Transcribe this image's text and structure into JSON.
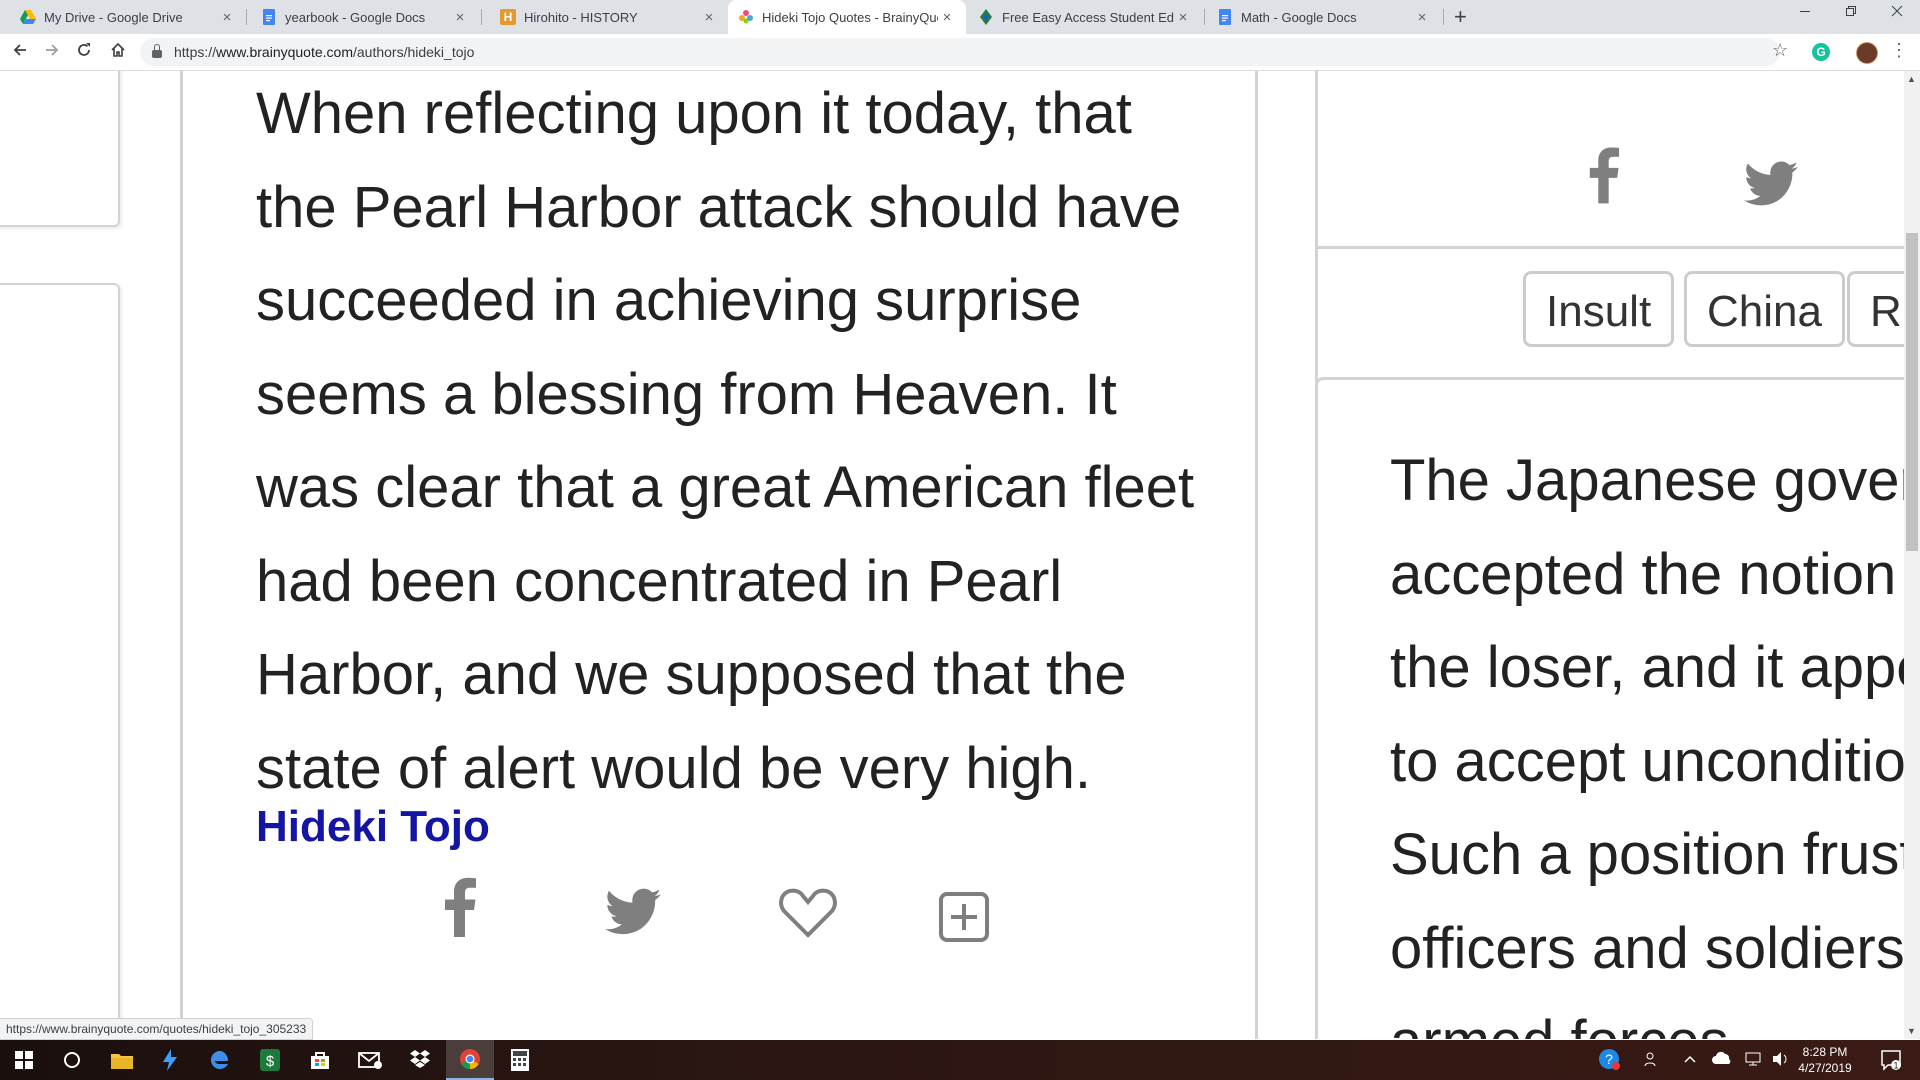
{
  "browser": {
    "tabs": [
      {
        "label": "My Drive - Google Drive",
        "icon": "google-drive-icon",
        "color": "#f4b400"
      },
      {
        "label": "yearbook - Google Docs",
        "icon": "google-docs-icon",
        "color": "#4285f4"
      },
      {
        "label": "Hirohito - HISTORY",
        "icon": "history-icon",
        "color": "#e39b2d"
      },
      {
        "label": "Hideki Tojo Quotes - BrainyQuot",
        "icon": "brainyquote-icon",
        "color": "#e94e77",
        "active": true
      },
      {
        "label": "Free Easy Access Student Edition",
        "icon": "student-edition-icon",
        "color": "#2e7d32"
      },
      {
        "label": "Math - Google Docs",
        "icon": "google-docs-icon",
        "color": "#4285f4"
      }
    ],
    "close_glyph": "×",
    "new_tab_glyph": "+",
    "url": {
      "scheme": "https://",
      "host": "www.brainyquote.com",
      "path": "/authors/hideki_tojo"
    },
    "status_url": "https://www.brainyquote.com/quotes/hideki_tojo_305233"
  },
  "page": {
    "quote_main": "When reflecting upon it today, that the Pearl Harbor attack should have succeeded in achieving surprise seems a blessing from Heaven. It was clear that a great American fleet had been concentrated in Pearl Harbor, and we supposed that the state of alert would be very high.",
    "author": "Hideki Tojo",
    "tags": [
      "Insult",
      "China",
      "R"
    ],
    "quote_side_lines": [
      "The Japanese gover",
      "accepted the notion",
      "the loser, and it appe",
      "to accept unconditio",
      "Such a position frust",
      "officers and soldiers",
      "armed forces"
    ],
    "link_color": "#1515a3"
  },
  "taskbar": {
    "time": "8:28 PM",
    "date": "4/27/2019"
  }
}
